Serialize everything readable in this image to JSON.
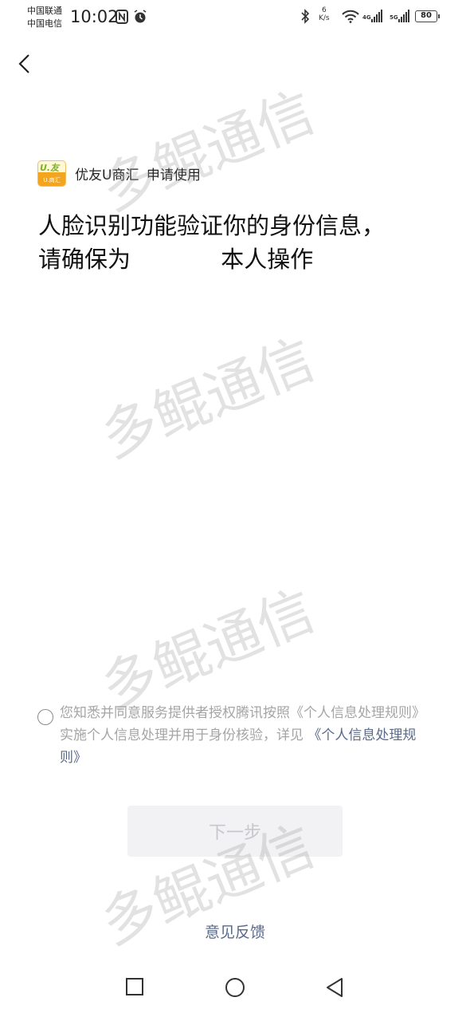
{
  "status_bar": {
    "carrier_1": "中国联通",
    "carrier_2": "中国电信",
    "time": "10:02",
    "net_speed_value": "6",
    "net_speed_unit": "K/s",
    "net_4g": "4G",
    "net_5g": "5G",
    "battery": "80"
  },
  "app": {
    "logo_top": "U.友",
    "logo_bottom": "U.商汇",
    "name": "优友U商汇",
    "request_text": "申请使用"
  },
  "headline": {
    "line1": "人脸识别功能验证你的身份信息，",
    "line2_prefix": "请确保为 ",
    "line2_suffix": "本人操作"
  },
  "consent": {
    "text": "您知悉并同意服务提供者授权腾讯按照《个人信息处理规则》实施个人信息处理并用于身份核验，详见 ",
    "link": "《个人信息处理规则》",
    "checked": false
  },
  "next_button_label": "下一步",
  "feedback_label": "意见反馈",
  "watermark": "多鲲通信"
}
